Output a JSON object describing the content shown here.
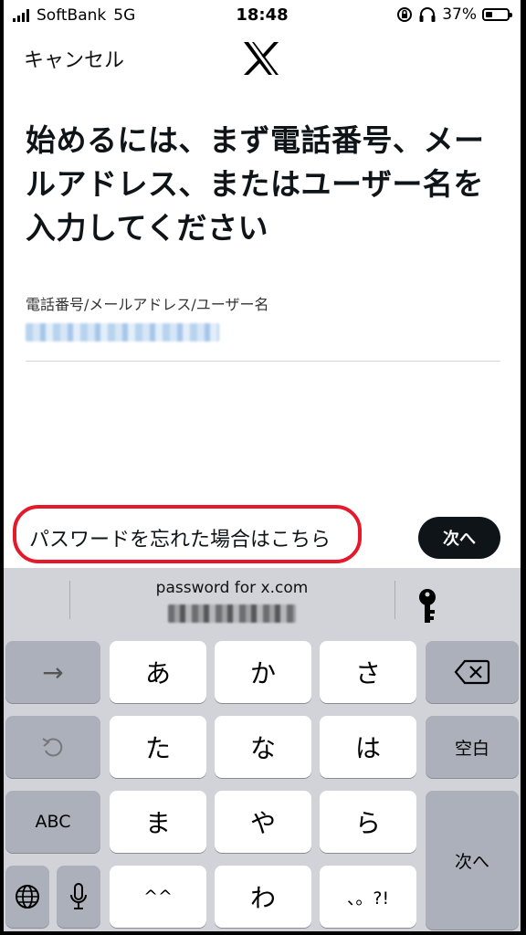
{
  "status_bar": {
    "carrier": "SoftBank",
    "network": "5G",
    "time": "18:48",
    "battery": "37%",
    "battery_level": 0.37
  },
  "header": {
    "cancel_label": "キャンセル",
    "logo_icon": "x-logo-icon"
  },
  "main": {
    "title": "始めるには、まず電話番号、メールアドレス、またはユーザー名を入力してください",
    "field_label": "電話番号/メールアドレス/ユーザー名"
  },
  "actions": {
    "forgot_password": "パスワードを忘れた場合はこちら",
    "highlight_color": "#e6182b",
    "next": "次へ"
  },
  "keyboard": {
    "quicktype_title": "password for x.com",
    "quicktype_icon": "key-icon",
    "rows": [
      [
        "→",
        "あ",
        "か",
        "さ",
        "⌫"
      ],
      [
        "↺",
        "た",
        "な",
        "は",
        "空白"
      ],
      [
        "ABC",
        "ま",
        "や",
        "ら",
        "次へ"
      ],
      [
        "🌐",
        "🎤",
        "^^",
        "わ",
        "、。?!"
      ]
    ],
    "labels": {
      "arrow": "→",
      "a": "あ",
      "ka": "か",
      "sa": "さ",
      "ta": "た",
      "na": "な",
      "ha": "は",
      "space": "空白",
      "abc": "ABC",
      "ma": "ま",
      "ya": "や",
      "ra": "ら",
      "enter": "次へ",
      "kao": "^^",
      "wa": "わ",
      "punct": "、。?!"
    }
  }
}
